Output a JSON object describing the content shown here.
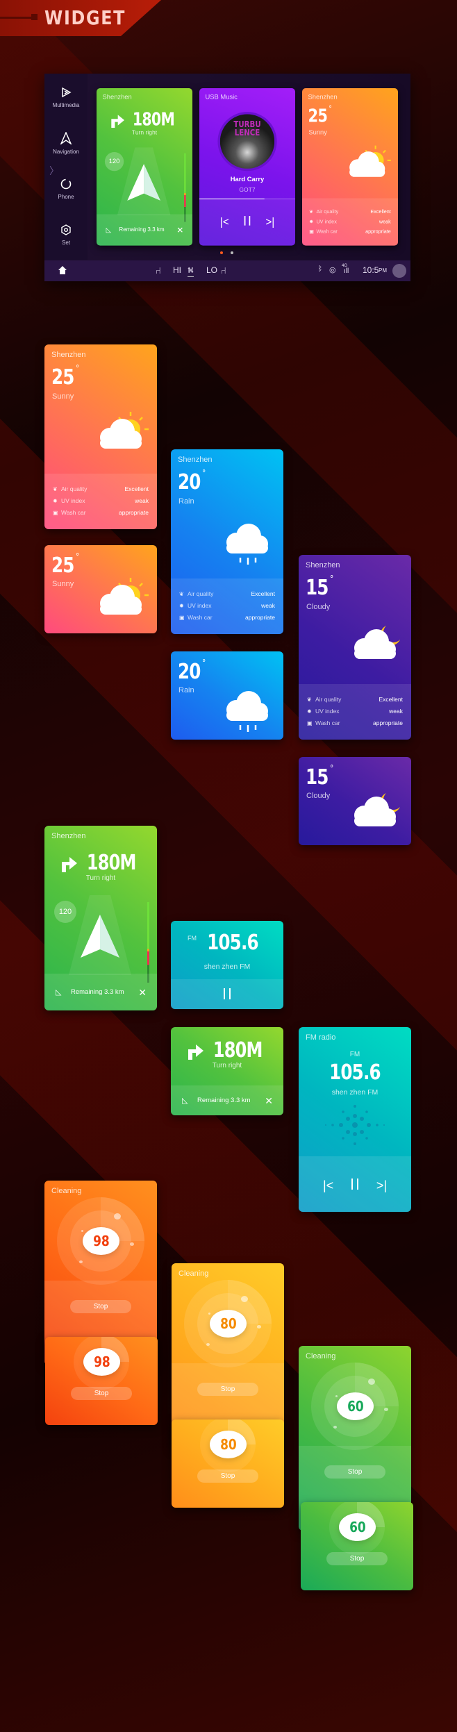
{
  "header": {
    "title": "WIDGET"
  },
  "dashboard": {
    "sidebar": [
      {
        "label": "Multimedia",
        "icon": "play-icon"
      },
      {
        "label": "Navigation",
        "icon": "navigation-icon"
      },
      {
        "label": "Phone",
        "icon": "phone-icon"
      },
      {
        "label": "Set",
        "icon": "settings-icon"
      }
    ],
    "expand_icon": "chevron-right-icon",
    "page_dots": {
      "count": 2,
      "active": 0,
      "active_color": "#ff5a1e"
    },
    "music": {
      "title": "USB Music",
      "album_art_text": "TURBU LENCE",
      "song": "Hard Carry",
      "artist": "GOT7",
      "progress": 0.68
    },
    "bottom_bar": {
      "home_icon": "home-icon",
      "hi": "HI",
      "lo": "LO",
      "time": "10:5",
      "ampm": "PM",
      "signal": "4G"
    }
  },
  "info_labels": [
    "Air quality",
    "UV index",
    "Wash car"
  ],
  "info_values": [
    "Excellent",
    "weak",
    "appropriate"
  ],
  "weather": {
    "sunny": {
      "title": "Shenzhen",
      "temp": "25",
      "unit": "°",
      "condition": "Sunny",
      "icon": "sun-cloud-icon"
    },
    "rain": {
      "title": "Shenzhen",
      "temp": "20",
      "unit": "°",
      "condition": "Rain",
      "icon": "rain-cloud-icon"
    },
    "cloudy": {
      "title": "Shenzhen",
      "temp": "15",
      "unit": "°",
      "condition": "Cloudy",
      "icon": "moon-cloud-icon"
    }
  },
  "navigation": {
    "title": "Shenzhen",
    "distance": "180M",
    "instruction": "Turn right",
    "speed_limit": "120",
    "remaining": "Remaining 3.3 km"
  },
  "radio": {
    "title": "FM radio",
    "band": "FM",
    "frequency": "105.6",
    "station": "shen zhen FM"
  },
  "cleaning": {
    "title": "Cleaning",
    "stop": "Stop",
    "orange": {
      "value": "98",
      "color": "#f2400e"
    },
    "yellow": {
      "value": "80",
      "color": "#f58a00"
    },
    "green": {
      "value": "60",
      "color": "#17a85a"
    }
  }
}
